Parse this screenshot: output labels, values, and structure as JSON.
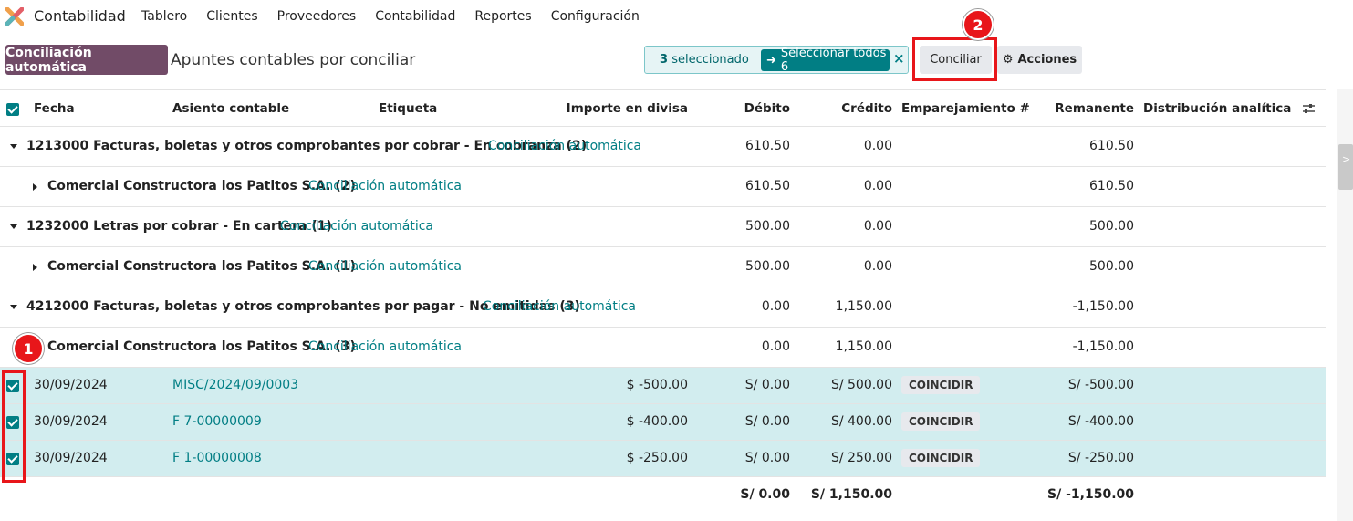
{
  "nav": {
    "app_title": "Contabilidad",
    "menu": [
      "Tablero",
      "Clientes",
      "Proveedores",
      "Contabilidad",
      "Reportes",
      "Configuración"
    ]
  },
  "controls": {
    "auto_button": "Conciliación automática",
    "breadcrumb": "Apuntes contables por conciliar",
    "selected_count": "3",
    "selected_label": "seleccionado",
    "select_all": "Seleccionar todos 6",
    "clear": "×",
    "conciliar": "Conciliar",
    "acciones": "Acciones"
  },
  "annotations": [
    "1",
    "2"
  ],
  "colors": {
    "brand": "#714b67",
    "accent": "#017e84",
    "highlight": "#e8161a",
    "selected_row": "#d2edef"
  },
  "table": {
    "headers": {
      "fecha": "Fecha",
      "asiento": "Asiento contable",
      "etiqueta": "Etiqueta",
      "importe": "Importe en divisa",
      "debito": "Débito",
      "credito": "Crédito",
      "emparejamiento": "Emparejamiento #",
      "remanente": "Remanente",
      "analitica": "Distribución analítica"
    },
    "groups": [
      {
        "title": "1213000 Facturas, boletas y otros comprobantes por cobrar - En cobranza (2)",
        "link": "Conciliación automática",
        "debito": "610.50",
        "credito": "0.00",
        "remanente": "610.50"
      },
      {
        "title": "Comercial Constructora los Patitos S.A. (2)",
        "link": "Conciliación automática",
        "debito": "610.50",
        "credito": "0.00",
        "remanente": "610.50"
      },
      {
        "title": "1232000 Letras por cobrar - En cartera (1)",
        "link": "Conciliación automática",
        "debito": "500.00",
        "credito": "0.00",
        "remanente": "500.00"
      },
      {
        "title": "Comercial Constructora los Patitos S.A. (1)",
        "link": "Conciliación automática",
        "debito": "500.00",
        "credito": "0.00",
        "remanente": "500.00"
      },
      {
        "title": "4212000 Facturas, boletas y otros comprobantes por pagar - No emitidas (3)",
        "link": "Conciliación automática",
        "debito": "0.00",
        "credito": "1,150.00",
        "remanente": "-1,150.00"
      },
      {
        "title": "Comercial Constructora los Patitos S.A. (3)",
        "link": "Conciliación automática",
        "debito": "0.00",
        "credito": "1,150.00",
        "remanente": "-1,150.00"
      }
    ],
    "rows": [
      {
        "fecha": "30/09/2024",
        "asiento": "MISC/2024/09/0003",
        "importe": "$ -500.00",
        "debito": "S/ 0.00",
        "credito": "S/ 500.00",
        "match": "COINCIDIR",
        "remanente": "S/ -500.00"
      },
      {
        "fecha": "30/09/2024",
        "asiento": "F 7-00000009",
        "importe": "$ -400.00",
        "debito": "S/ 0.00",
        "credito": "S/ 400.00",
        "match": "COINCIDIR",
        "remanente": "S/ -400.00"
      },
      {
        "fecha": "30/09/2024",
        "asiento": "F 1-00000008",
        "importe": "$ -250.00",
        "debito": "S/ 0.00",
        "credito": "S/ 250.00",
        "match": "COINCIDIR",
        "remanente": "S/ -250.00"
      }
    ],
    "totals": {
      "debito": "S/ 0.00",
      "credito": "S/ 1,150.00",
      "remanente": "S/ -1,150.00"
    }
  },
  "sidebar_toggle": ">"
}
